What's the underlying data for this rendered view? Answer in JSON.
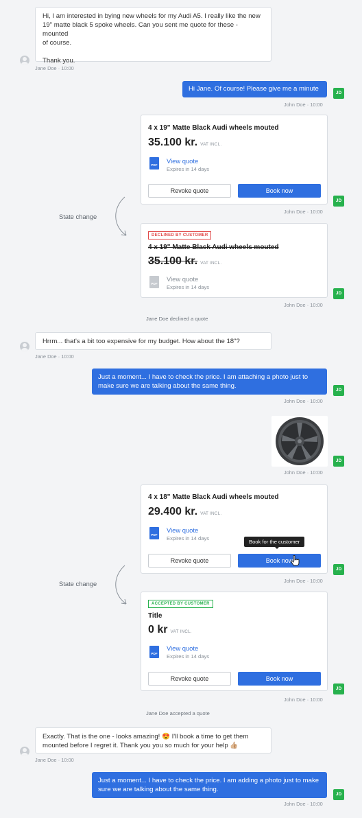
{
  "messages": {
    "m1": {
      "lines": [
        "Hi, I am interested in bying new wheels for my Audi A5. I really like the new",
        "19\" matte black 5 spoke wheels. Can you sent me quote for these - mounted",
        "of course.",
        "",
        "Thank you."
      ],
      "meta": "Jane Doe · 10:00"
    },
    "m2": {
      "text": "Hi Jane. Of course! Please give me a minute",
      "meta": "John Doe · 10:00",
      "avatar": "JD"
    },
    "m3": {
      "text": "Hrrm... that's a bit too expensive for my budget. How about the 18\"?",
      "meta": "Jane Doe · 10:00"
    },
    "m4": {
      "lines": [
        "Just a moment... I have to check the price. I am attaching a photo just to",
        "make sure we are talking about the same thing."
      ],
      "meta": "John Doe · 10:00",
      "avatar": "JD"
    },
    "m5": {
      "meta": "John Doe · 10:00",
      "avatar": "JD",
      "image_icon": "wheel-photo"
    },
    "m6": {
      "lines": [
        "Exactly. That is the one - looks amazing! 😍 I'll book a time to get them",
        "mounted before I regret it. Thank you you so much for your help 👍🏼"
      ],
      "meta": "Jane Doe · 10:00"
    },
    "m7": {
      "lines": [
        "Just a moment... I have to check the price. I am adding a photo just to make",
        "sure we are talking about the same thing."
      ],
      "meta": "John Doe · 10:00",
      "avatar": "JD"
    }
  },
  "quotes": {
    "q1": {
      "title": "4 x 19\" Matte Black Audi wheels mouted",
      "price": "35.100 kr.",
      "vat": "VAT INCL.",
      "view": "View quote",
      "expires": "Expires in 14 days",
      "pdf": "PDF",
      "revoke": "Revoke quote",
      "book": "Book now",
      "meta": "John Doe · 10:00",
      "avatar": "JD"
    },
    "q2": {
      "badge": "DECLINED BY CUSTOMER",
      "title": "4 x 19\" Matte Black Audi wheels mouted",
      "price": "35.100 kr.",
      "vat": "VAT INCL.",
      "view": "View quote",
      "expires": "Expires in 14 days",
      "pdf": "PDF",
      "meta": "John Doe · 10:00",
      "avatar": "JD"
    },
    "q3": {
      "title": "4 x 18\" Matte Black Audi wheels mouted",
      "price": "29.400 kr.",
      "vat": "VAT INCL.",
      "view": "View quote",
      "expires": "Expires in 14 days",
      "pdf": "PDF",
      "revoke": "Revoke quote",
      "book": "Book now",
      "tooltip": "Book for the customer",
      "meta": "John Doe · 10:00",
      "avatar": "JD"
    },
    "q4": {
      "badge": "ACCEPTED BY CUSTOMER",
      "title": "Title",
      "price": "0 kr",
      "vat": "VAT INCL.",
      "view": "View quote",
      "expires": "Expires in 14 days",
      "pdf": "PDF",
      "revoke": "Revoke quote",
      "book": "Book now",
      "meta": "John Doe · 10:00",
      "avatar": "JD"
    }
  },
  "annotations": {
    "state_change_1": "State change",
    "state_change_2": "State change"
  },
  "system": {
    "declined": "Jane Doe declined a quote",
    "accepted": "Jane Doe accepted a quote"
  },
  "colors": {
    "accent": "#2f6fe0",
    "avatar_green": "#27b14d",
    "declined": "#e04848",
    "accepted": "#27b14d",
    "background": "#f3f4f6"
  }
}
